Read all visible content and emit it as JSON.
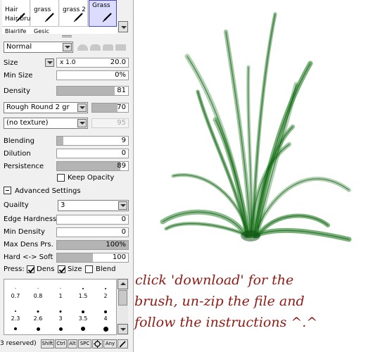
{
  "brushes": {
    "cells": [
      {
        "name": "Hair",
        "sub": "Hair bru"
      },
      {
        "name": "grass",
        "sub": ""
      },
      {
        "name": "grass 2",
        "sub": ""
      },
      {
        "name": "Grass",
        "sub": ""
      }
    ],
    "row2": [
      "Blairlife",
      "Gesic"
    ]
  },
  "blend_mode": "Normal",
  "size": {
    "label": "Size",
    "multiplier": "x 1.0",
    "value": "20.0"
  },
  "min_size": {
    "label": "Min Size",
    "value": "0%",
    "level": 0
  },
  "density": {
    "label": "Density",
    "value": "81",
    "level": 0.81
  },
  "shape": {
    "name": "Rough Round 2 gr",
    "value": "70",
    "level": 0.7
  },
  "texture": {
    "name": "(no texture)",
    "value": "95"
  },
  "blending": {
    "label": "Blending",
    "value": "9",
    "level": 0.09
  },
  "dilution": {
    "label": "Dilution",
    "value": "0",
    "level": 0
  },
  "persistence": {
    "label": "Persistence",
    "value": "89",
    "level": 0.89
  },
  "keep_opacity": {
    "label": "Keep Opacity",
    "checked": false
  },
  "advanced": {
    "label": "Advanced Settings"
  },
  "quality": {
    "label": "Quailty",
    "value": "3"
  },
  "edge_hardness": {
    "label": "Edge Hardness",
    "value": "0",
    "level": 0
  },
  "min_density": {
    "label": "Min Density",
    "value": "0",
    "level": 0
  },
  "max_dens_prs": {
    "label": "Max Dens Prs.",
    "value": "100%",
    "level": 1
  },
  "hard_soft": {
    "label": "Hard <-> Soft",
    "value": "100",
    "level": 0.5
  },
  "press": {
    "label": "Press:",
    "dens": {
      "label": "Dens",
      "checked": true
    },
    "size": {
      "label": "Size",
      "checked": true
    },
    "blend": {
      "label": "Blend",
      "checked": false
    }
  },
  "dot_sizes": {
    "row1": [
      "0.7",
      "0.8",
      "1",
      "1.5",
      "2"
    ],
    "row2": [
      "2.3",
      "2.6",
      "3",
      "3.5",
      "4"
    ]
  },
  "bottom": {
    "reserved": "3 reserved)",
    "keys": [
      "Shift",
      "Ctrl",
      "Alt",
      "SPC",
      "Any"
    ]
  },
  "note": {
    "lines": [
      "click 'download' for the",
      "brush, un-zip the file and",
      "follow the instructions ^.^"
    ]
  },
  "colors": {
    "note": "#8e1a14",
    "grass": "#1a7a1a",
    "selected": "#dcdcff"
  }
}
